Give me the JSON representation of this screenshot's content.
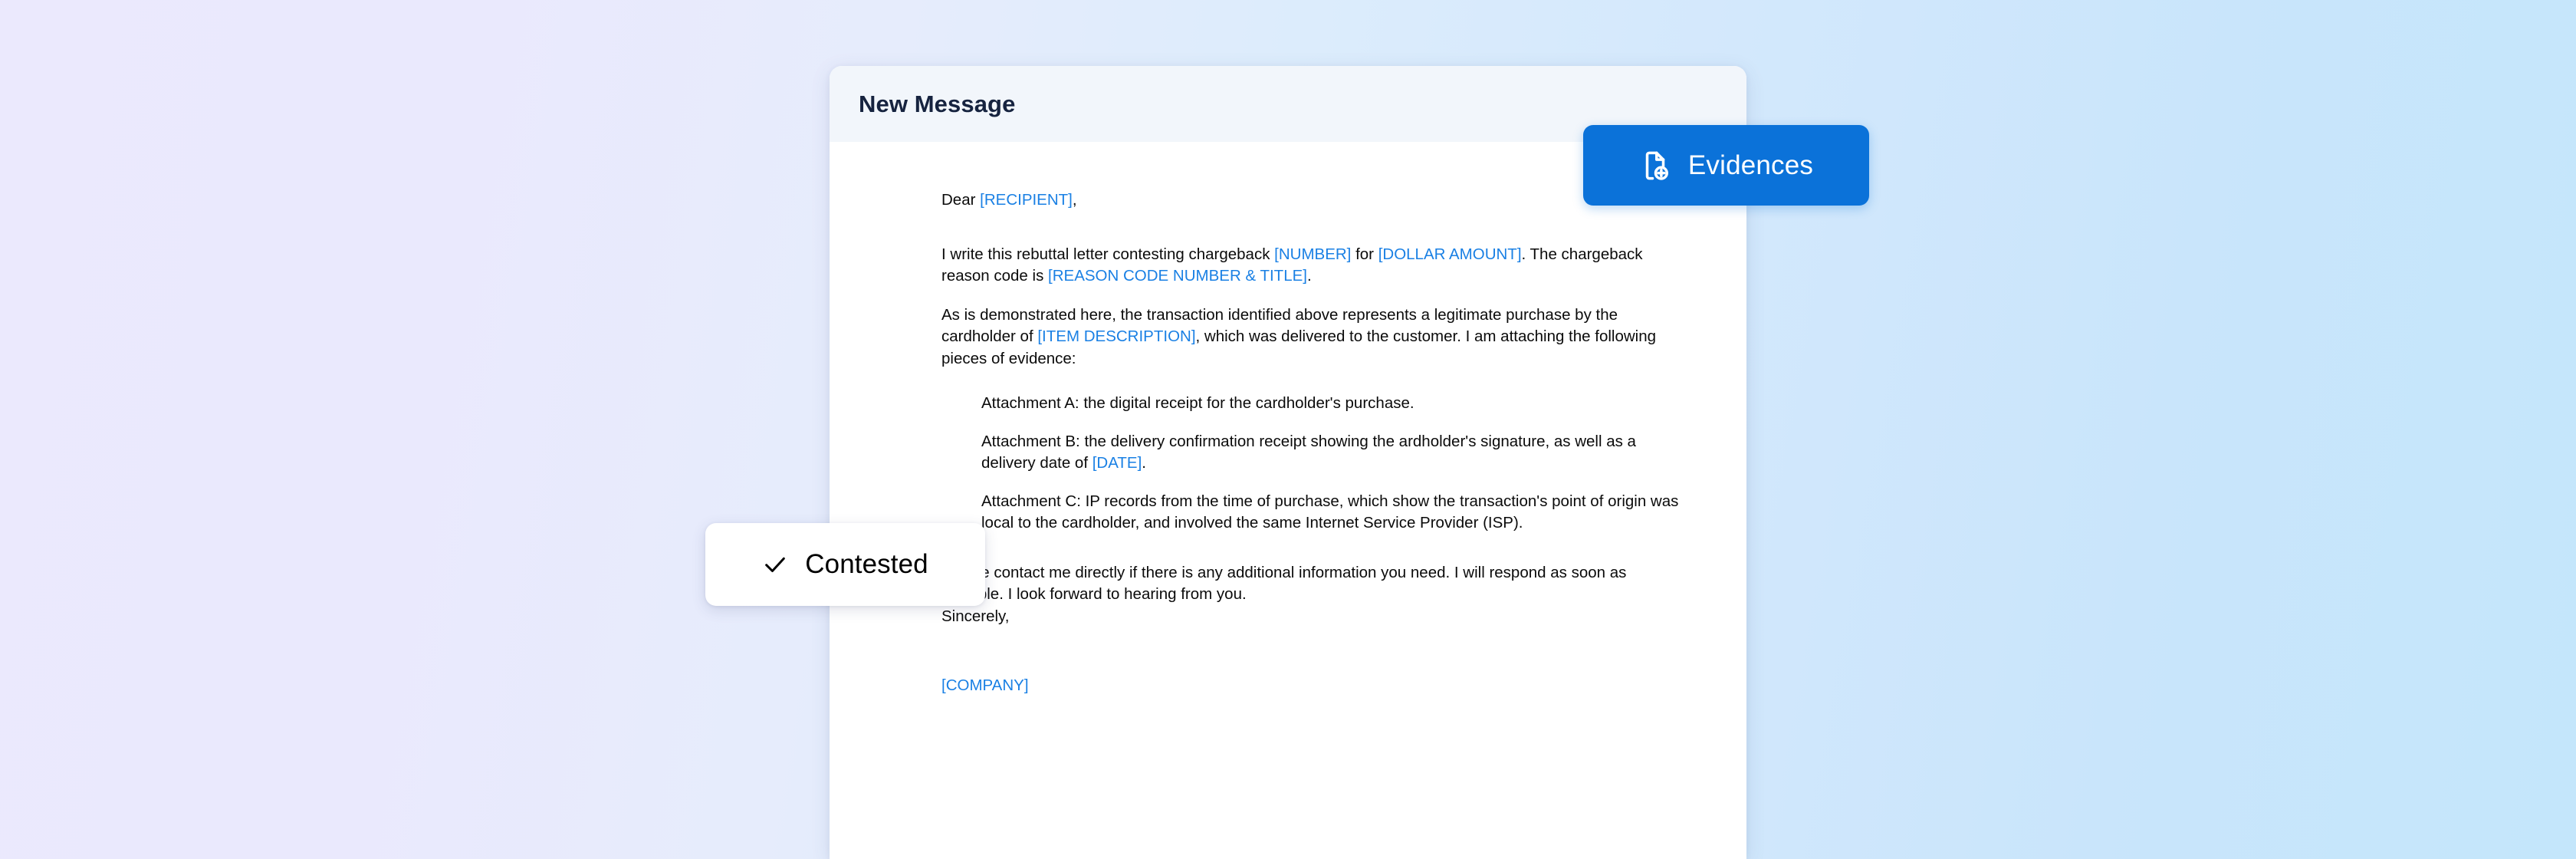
{
  "theme": {
    "background_left": "#ebe9fd",
    "background_right": "#c4e6fb",
    "accent_blue": "#0b72d9",
    "placeholder_blue": "#1a80e4",
    "header_band": "#f2f6fb",
    "title_color": "#16233f"
  },
  "compose": {
    "title": "New Message",
    "letter": {
      "greeting_prefix": "Dear ",
      "greeting_placeholder": "[RECIPIENT]",
      "greeting_suffix": ",",
      "para1": {
        "seg1": "I write this rebuttal letter contesting chargeback ",
        "ph1": "[NUMBER]",
        "seg2": " for ",
        "ph2": "[DOLLAR AMOUNT]",
        "seg3": ". The chargeback reason code is ",
        "ph3": "[REASON CODE NUMBER & TITLE]",
        "seg4": "."
      },
      "para2": {
        "seg1": "As is demonstrated here, the transaction identified above represents a legitimate purchase by the cardholder of ",
        "ph1": "[ITEM DESCRIPTION]",
        "seg2": ", which was delivered to the customer. I am attaching the following pieces of evidence:"
      },
      "attachments": [
        {
          "seg1": "Attachment A: the digital receipt for the cardholder's purchase.",
          "ph1": "",
          "seg2": ""
        },
        {
          "seg1": "Attachment B: the delivery confirmation receipt showing the ardholder's signature, as well as a delivery date of ",
          "ph1": "[DATE]",
          "seg2": "."
        },
        {
          "seg1": "Attachment C: IP records from the time of purchase, which show the transaction's point of origin was local to the cardholder, and involved the same Internet Service Provider (ISP).",
          "ph1": "",
          "seg2": ""
        }
      ],
      "closing_line1": "Please contact me directly if there is any additional information you need. I will respond as soon as possible. I look forward to hearing from you.",
      "closing_line2": "Sincerely,",
      "company_placeholder": "[COMPANY]"
    }
  },
  "evidences_button": {
    "label": "Evidences",
    "icon": "file-plus-icon"
  },
  "contested_badge": {
    "label": "Contested",
    "icon": "check-icon"
  }
}
